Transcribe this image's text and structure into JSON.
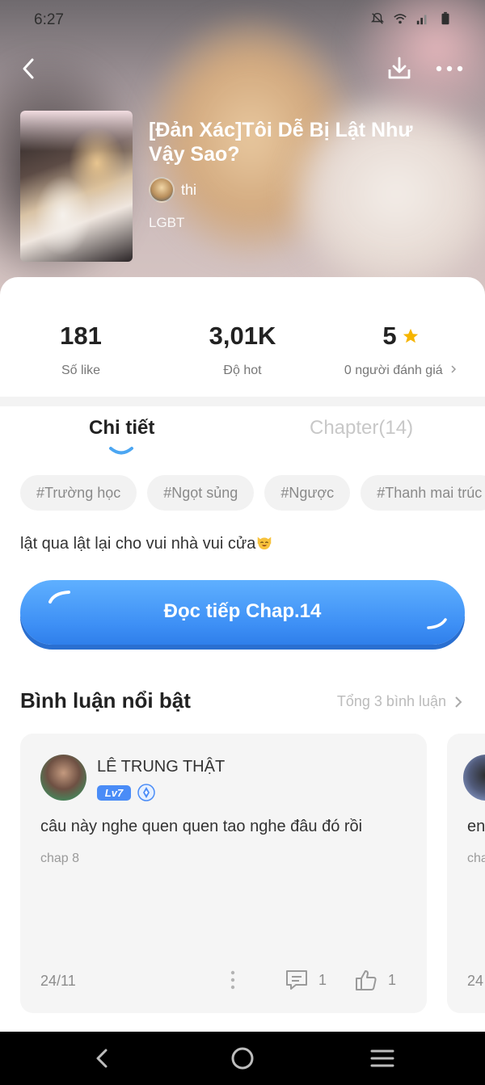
{
  "status_bar": {
    "time": "6:27"
  },
  "book": {
    "title": "[Đản Xác]Tôi Dễ Bị Lật Như Vậy Sao?",
    "author": "thi",
    "genre": "LGBT"
  },
  "stats": [
    {
      "value": "181",
      "label": "Số like"
    },
    {
      "value": "3,01K",
      "label": "Độ hot"
    },
    {
      "value": "5",
      "label": "0 người đánh giá"
    }
  ],
  "tabs": {
    "detail": "Chi tiết",
    "chapters": "Chapter(14)"
  },
  "tags": [
    "#Trường học",
    "#Ngọt sủng",
    "#Ngược",
    "#Thanh mai trúc"
  ],
  "description": "lật qua lật lại cho vui nhà vui cửa",
  "read_button": "Đọc tiếp Chap.14",
  "comments_section": {
    "title": "Bình luận nổi bật",
    "total": "Tổng 3 bình luận",
    "comments": [
      {
        "name": "LÊ TRUNG THẬT",
        "level": "Lv7",
        "text": "câu này nghe quen quen tao nghe đâu đó rồi",
        "chapter": "chap 8",
        "date": "24/11",
        "replies": "1",
        "likes": "1"
      },
      {
        "text": "en",
        "chapter": "cha",
        "date": "24"
      }
    ]
  },
  "colors": {
    "accent": "#3d8ff5",
    "star": "#f6b500",
    "level_badge": "#4a8cf7"
  },
  "icons": [
    "back-icon",
    "download-icon",
    "more-icon",
    "star-icon",
    "chevron-right-icon",
    "comment-icon",
    "thumbs-up-icon",
    "kebab-icon"
  ]
}
